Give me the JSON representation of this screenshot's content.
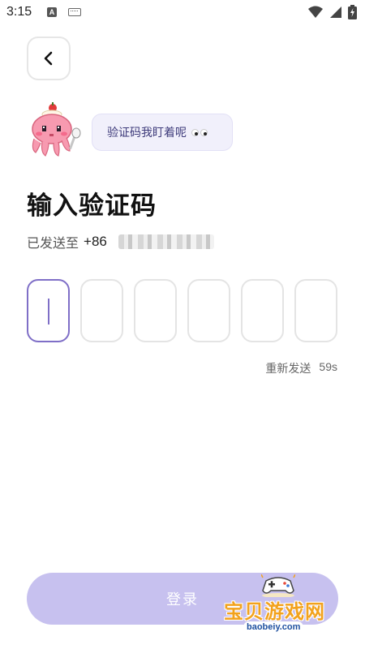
{
  "status_bar": {
    "time": "3:15",
    "icons": [
      "text-a-icon",
      "keyboard-icon",
      "wifi-icon",
      "signal-icon",
      "battery-charging-icon"
    ]
  },
  "back_button": {
    "icon": "chevron-left-icon"
  },
  "mascot": {
    "icon": "octopus-mascot-icon"
  },
  "bubble": {
    "text": "验证码我盯着呢",
    "icon": "eyes-icon"
  },
  "title": "输入验证码",
  "sent": {
    "label": "已发送至",
    "country_code": "+86"
  },
  "code_boxes": {
    "count": 6,
    "active_index": 0
  },
  "resend": {
    "label": "重新发送",
    "countdown": "59s"
  },
  "login_button": {
    "label": "登录"
  },
  "watermark": {
    "text": "宝贝游戏网",
    "url": "baobeiy.com"
  },
  "colors": {
    "accent": "#7f6fc7",
    "button": "#c7c1ef",
    "bubble": "#f1f0fb"
  }
}
